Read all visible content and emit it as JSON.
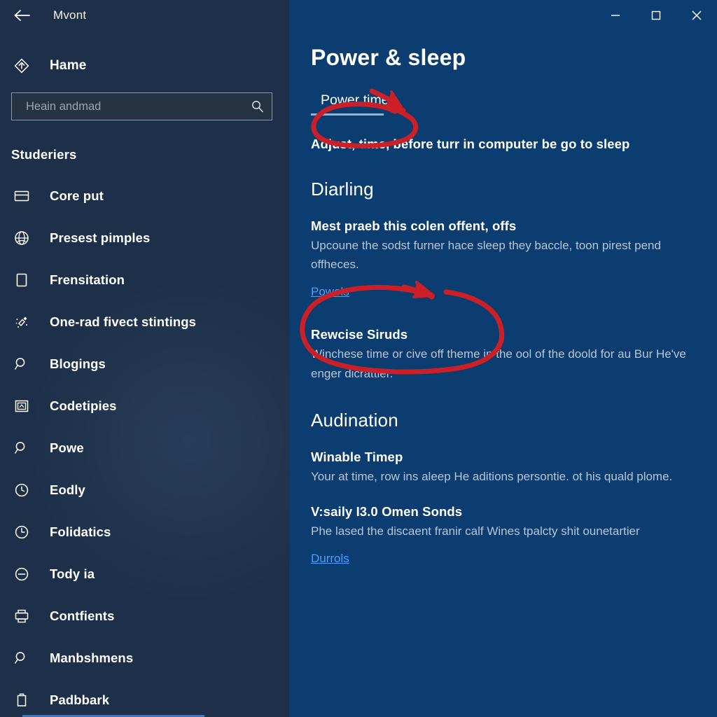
{
  "window": {
    "title": "Mvont",
    "back_icon": "arrow-left-icon",
    "controls": [
      {
        "name": "minimize",
        "glyph": "minimize-icon"
      },
      {
        "name": "maximize",
        "glyph": "maximize-icon"
      },
      {
        "name": "close",
        "glyph": "close-icon"
      }
    ]
  },
  "sidebar": {
    "home": {
      "label": "Hame",
      "icon": "home-icon"
    },
    "search": {
      "placeholder": "Heain andmad",
      "value": "",
      "icon": "search-icon"
    },
    "section_heading": "Studeriers",
    "accent_color": "#3f79c0",
    "background": "#1e3049",
    "items": [
      {
        "label": "Core put",
        "icon": "display-icon"
      },
      {
        "label": "Presest pimples",
        "icon": "globe-icon"
      },
      {
        "label": "Frensitation",
        "icon": "tablet-icon"
      },
      {
        "label": "One-rad fivect stintings",
        "icon": "personalization-icon"
      },
      {
        "label": "Blogings",
        "icon": "search-icon"
      },
      {
        "label": "Codetipies",
        "icon": "apps-icon"
      },
      {
        "label": "Powe",
        "icon": "search-icon"
      },
      {
        "label": "Eodly",
        "icon": "clock-icon"
      },
      {
        "label": "Folidatics",
        "icon": "clock-icon"
      },
      {
        "label": "Tody ia",
        "icon": "minus-circle-icon"
      },
      {
        "label": "Contfients",
        "icon": "printer-icon"
      },
      {
        "label": "Manbshmens",
        "icon": "search-icon"
      },
      {
        "label": "Padbbark",
        "icon": "clipboard-icon"
      }
    ]
  },
  "main": {
    "background": "#0c3d70",
    "page_title": "Power & sleep",
    "tab": {
      "label": "Power time",
      "underline_color": "#8fb4d8"
    },
    "subtitle": "Adjust, time, before turr in computer be go to sleep",
    "sections": [
      {
        "heading": "Diarling",
        "blocks": [
          {
            "title": "Mest praeb this colen offent, offs",
            "body": "Upcoune the sodst furner hace sleep they baccle, toon pirest pend offheces.",
            "link": "Powols"
          },
          {
            "title": "Rewcise Siruds",
            "body": "Winchese time or cive off theme in the ool of the doold for au Bur He've enger dicrattier.",
            "link": ""
          }
        ]
      },
      {
        "heading": "Audination",
        "blocks": [
          {
            "title": "Winable Timep",
            "body": "Your at time, row ins aleep He aditions persontie. ot his quald plome.",
            "link": ""
          },
          {
            "title": "V:saily I3.0 Omen Sonds",
            "body": "Phe lased the discaent franir calf Wines tpalcty shit ounetartier",
            "link": "Durrols"
          }
        ]
      }
    ]
  },
  "annotations": {
    "color": "#cc2026",
    "shapes": [
      {
        "name": "power-time-circle",
        "type": "ellipse-with-arrow"
      },
      {
        "name": "rewcise-siruds-circle",
        "type": "ellipse-with-arrow"
      }
    ]
  }
}
